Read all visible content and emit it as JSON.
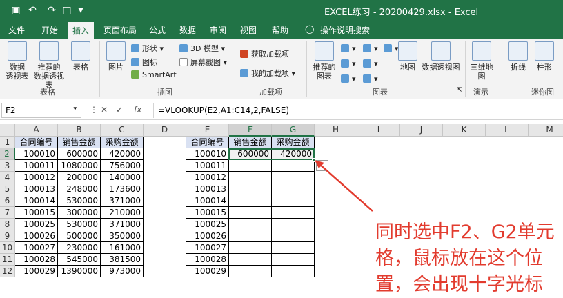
{
  "window": {
    "title": "EXCEL练习 - 20200429.xlsx - Excel",
    "qat": [
      "save-icon",
      "undo-icon",
      "redo-icon",
      "folder-icon",
      "customize-icon"
    ]
  },
  "tabs": [
    "文件",
    "开始",
    "插入",
    "页面布局",
    "公式",
    "数据",
    "审阅",
    "视图",
    "帮助",
    "操作说明搜索"
  ],
  "active_tab": "插入",
  "ribbon": {
    "table_group": {
      "label": "表格",
      "buttons": [
        "数据\n透视表",
        "推荐的\n数据透视表",
        "表格"
      ]
    },
    "illustration_group": {
      "label": "插图",
      "big": "图片",
      "small": [
        "形状",
        "图标",
        "SmartArt",
        "3D 模型",
        "屏幕截图"
      ]
    },
    "addin_group": {
      "label": "加载项",
      "items": [
        "获取加载项",
        "我的加载项"
      ]
    },
    "chart_group": {
      "label": "图表",
      "buttons": [
        "推荐的\n图表",
        "地图",
        "数据透视图"
      ]
    },
    "tour_group": {
      "label": "演示",
      "buttons": [
        "三维地\n图"
      ]
    },
    "spark_group": {
      "label": "迷你图",
      "buttons": [
        "折线",
        "柱形"
      ]
    }
  },
  "formula_bar": {
    "name_box": "F2",
    "formula": "=VLOOKUP(E2,A1:C14,2,FALSE)",
    "fx": "fx"
  },
  "columns": [
    "A",
    "B",
    "C",
    "D",
    "E",
    "F",
    "G",
    "H",
    "I",
    "J",
    "K",
    "L",
    "M"
  ],
  "rows": [
    "1",
    "2",
    "3",
    "4",
    "5",
    "6",
    "7",
    "8",
    "9",
    "10",
    "11",
    "12"
  ],
  "source_table": {
    "headers": [
      "合同编号",
      "销售金额",
      "采购金额"
    ],
    "rows": [
      [
        "100010",
        "600000",
        "420000"
      ],
      [
        "100011",
        "1080000",
        "756000"
      ],
      [
        "100012",
        "200000",
        "140000"
      ],
      [
        "100013",
        "248000",
        "173600"
      ],
      [
        "100014",
        "530000",
        "371000"
      ],
      [
        "100015",
        "300000",
        "210000"
      ],
      [
        "100025",
        "530000",
        "371000"
      ],
      [
        "100026",
        "500000",
        "350000"
      ],
      [
        "100027",
        "230000",
        "161000"
      ],
      [
        "100028",
        "545000",
        "381500"
      ],
      [
        "100029",
        "1390000",
        "973000"
      ]
    ]
  },
  "lookup_table": {
    "headers": [
      "合同编号",
      "销售金额",
      "采购金额"
    ],
    "rows": [
      [
        "100010",
        "600000",
        "420000"
      ],
      [
        "100011",
        "",
        ""
      ],
      [
        "100012",
        "",
        ""
      ],
      [
        "100013",
        "",
        ""
      ],
      [
        "100014",
        "",
        ""
      ],
      [
        "100015",
        "",
        ""
      ],
      [
        "100025",
        "",
        ""
      ],
      [
        "100026",
        "",
        ""
      ],
      [
        "100027",
        "",
        ""
      ],
      [
        "100028",
        "",
        ""
      ],
      [
        "100029",
        "",
        ""
      ]
    ]
  },
  "annotation": "同时选中F2、G2单元格，鼠标放在这个位置，会出现十字光标",
  "colors": {
    "excel_green": "#217346",
    "header_fill": "#d9e1f2",
    "annotation_red": "#e23b2e"
  }
}
